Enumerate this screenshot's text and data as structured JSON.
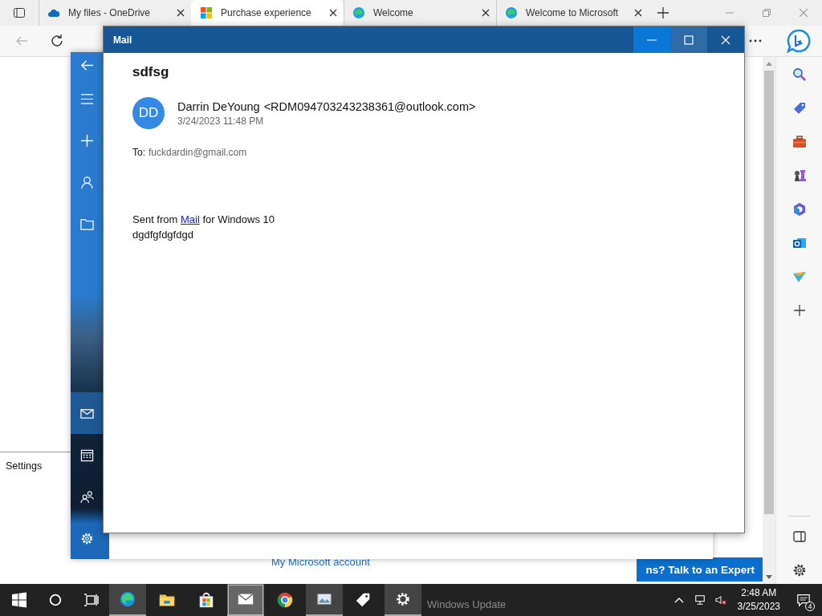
{
  "browser": {
    "tabs": [
      {
        "label": "My files - OneDrive",
        "selected": false
      },
      {
        "label": "Purchase experience",
        "selected": true
      },
      {
        "label": "Welcome",
        "selected": false
      },
      {
        "label": "Welcome to Microsoft",
        "selected": false
      }
    ]
  },
  "page": {
    "settings_label": "Settings",
    "account_link": "My Microsoft account",
    "banner": "ns? Talk to an Expert"
  },
  "mail_back": {
    "rail": [
      {
        "kind": "back",
        "selected": false
      },
      {
        "kind": "menu",
        "selected": false
      },
      {
        "kind": "plus",
        "selected": false
      },
      {
        "kind": "person",
        "selected": false
      },
      {
        "kind": "folder",
        "selected": false
      },
      {
        "kind": "mail",
        "selected": true
      },
      {
        "kind": "calendar",
        "selected": false
      },
      {
        "kind": "people",
        "selected": false
      },
      {
        "kind": "gear",
        "selected": false
      }
    ]
  },
  "mail": {
    "title": "Mail",
    "subject": "sdfsg",
    "avatar": "DD",
    "sender": "Darrin DeYoung",
    "address": "<RDM094703243238361@outlook.com>",
    "date": "3/24/2023 11:48 PM",
    "to_label": "To:",
    "to": "fuckdardin@gmail.com",
    "signature": {
      "before": "Sent from",
      "link": "Mail",
      "after": "for Windows 10"
    },
    "body": "dgdfgfdgfdgd"
  },
  "taskbar": {
    "apps": [
      {
        "kind": "edge",
        "active": true
      },
      {
        "kind": "explorer",
        "active": false
      },
      {
        "kind": "store",
        "active": false
      },
      {
        "kind": "mail",
        "active": true
      },
      {
        "kind": "chrome",
        "active": false
      },
      {
        "kind": "photos",
        "active": true
      },
      {
        "kind": "tag",
        "active": false
      },
      {
        "kind": "settings",
        "active": true
      }
    ],
    "ghost_label": "Windows Update",
    "time": "2:48 AM",
    "date": "3/25/2023",
    "notifications": "4"
  }
}
